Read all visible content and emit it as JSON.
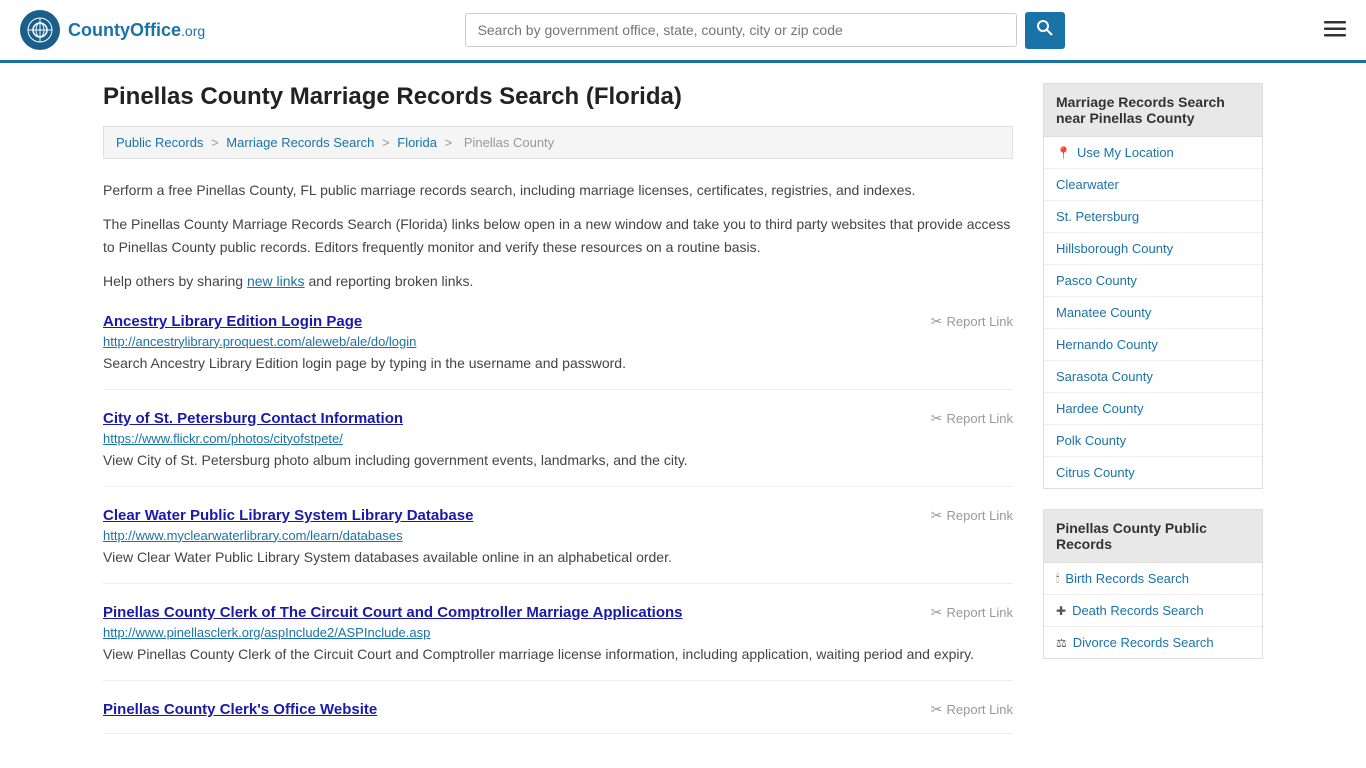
{
  "header": {
    "logo_text": "County",
    "logo_tld": "Office.org",
    "search_placeholder": "Search by government office, state, county, city or zip code",
    "search_btn_icon": "🔍"
  },
  "breadcrumb": {
    "items": [
      "Public Records",
      "Marriage Records Search",
      "Florida",
      "Pinellas County"
    ]
  },
  "page": {
    "title": "Pinellas County Marriage Records Search (Florida)",
    "desc1": "Perform a free Pinellas County, FL public marriage records search, including marriage licenses, certificates, registries, and indexes.",
    "desc2": "The Pinellas County Marriage Records Search (Florida) links below open in a new window and take you to third party websites that provide access to Pinellas County public records. Editors frequently monitor and verify these resources on a routine basis.",
    "desc3_prefix": "Help others by sharing ",
    "desc3_link": "new links",
    "desc3_suffix": " and reporting broken links."
  },
  "results": [
    {
      "title": "Ancestry Library Edition Login Page",
      "url": "http://ancestrylibrary.proquest.com/aleweb/ale/do/login",
      "desc": "Search Ancestry Library Edition login page by typing in the username and password.",
      "report": "Report Link"
    },
    {
      "title": "City of St. Petersburg Contact Information",
      "url": "https://www.flickr.com/photos/cityofstpete/",
      "desc": "View City of St. Petersburg photo album including government events, landmarks, and the city.",
      "report": "Report Link"
    },
    {
      "title": "Clear Water Public Library System Library Database",
      "url": "http://www.myclearwaterlibrary.com/learn/databases",
      "desc": "View Clear Water Public Library System databases available online in an alphabetical order.",
      "report": "Report Link"
    },
    {
      "title": "Pinellas County Clerk of The Circuit Court and Comptroller Marriage Applications",
      "url": "http://www.pinellasclerk.org/aspInclude2/ASPInclude.asp",
      "desc": "View Pinellas County Clerk of the Circuit Court and Comptroller marriage license information, including application, waiting period and expiry.",
      "report": "Report Link"
    },
    {
      "title": "Pinellas County Clerk's Office Website",
      "url": "",
      "desc": "",
      "report": "Report Link"
    }
  ],
  "sidebar": {
    "nearby_header": "Marriage Records Search near Pinellas County",
    "nearby_items": [
      {
        "label": "Use My Location",
        "icon": "📍",
        "is_location": true
      },
      {
        "label": "Clearwater",
        "icon": ""
      },
      {
        "label": "St. Petersburg",
        "icon": ""
      },
      {
        "label": "Hillsborough County",
        "icon": ""
      },
      {
        "label": "Pasco County",
        "icon": ""
      },
      {
        "label": "Manatee County",
        "icon": ""
      },
      {
        "label": "Hernando County",
        "icon": ""
      },
      {
        "label": "Sarasota County",
        "icon": ""
      },
      {
        "label": "Hardee County",
        "icon": ""
      },
      {
        "label": "Polk County",
        "icon": ""
      },
      {
        "label": "Citrus County",
        "icon": ""
      }
    ],
    "public_records_header": "Pinellas County Public Records",
    "public_records_items": [
      {
        "label": "Birth Records Search",
        "icon": "🕯"
      },
      {
        "label": "Death Records Search",
        "icon": "✚"
      },
      {
        "label": "Divorce Records Search",
        "icon": "⚖"
      }
    ]
  }
}
